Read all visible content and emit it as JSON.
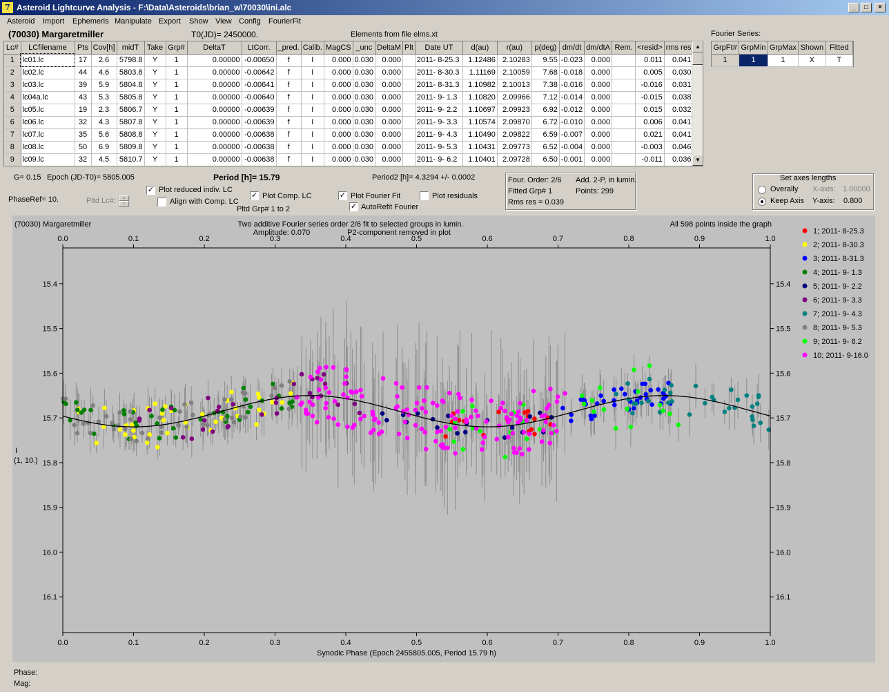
{
  "window": {
    "title": "Asteroid Lightcurve Analysis - F:\\Data\\Asteroids\\brian_w\\70030\\ini.alc",
    "app_icon": "7",
    "buttons": {
      "minimize": "_",
      "maximize": "□",
      "close": "×"
    }
  },
  "menu": [
    "Asteroid",
    "Import",
    "Ephemeris",
    "Manipulate",
    "Export",
    "Show",
    "View",
    "Config",
    "FourierFit"
  ],
  "header": {
    "asteroid": "(70030) Margaretmiller",
    "t0": "T0(JD)= 2450000.",
    "elements": "Elements from file elms.xt"
  },
  "table": {
    "columns": [
      "Lc#",
      "LCfilename",
      "Pts",
      "Cov[h]",
      "midT",
      "Take",
      "Grp#",
      "DeltaT",
      "LtCorr.",
      "_pred.",
      "Calib.",
      "MagCS",
      "_unc",
      "DeltaM",
      "Plt",
      "Date UT",
      "d(au)",
      "r(au)",
      "p(deg)",
      "dm/dt",
      "dm/dtA",
      "Rem.",
      "<resid>",
      "rms res"
    ],
    "rows": [
      [
        "1",
        "lc01.lc",
        "17",
        "2.6",
        "5798.8",
        "Y",
        "1",
        "0.00000",
        "-0.00650",
        "f",
        "I",
        "0.000",
        "0.030",
        "0.000",
        "",
        "2011- 8-25.3",
        "1.12486",
        "2.10283",
        "9.55",
        "-0.023",
        "0.000",
        "",
        "0.011",
        "0.041"
      ],
      [
        "2",
        "lc02.lc",
        "44",
        "4.6",
        "5803.8",
        "Y",
        "1",
        "0.00000",
        "-0.00642",
        "f",
        "I",
        "0.000",
        "0.030",
        "0.000",
        "",
        "2011- 8-30.3",
        "1.11169",
        "2.10059",
        "7.68",
        "-0.018",
        "0.000",
        "",
        "0.005",
        "0.030"
      ],
      [
        "3",
        "lc03.lc",
        "39",
        "5.9",
        "5804.8",
        "Y",
        "1",
        "0.00000",
        "-0.00641",
        "f",
        "I",
        "0.000",
        "0.030",
        "0.000",
        "",
        "2011- 8-31.3",
        "1.10982",
        "2.10013",
        "7.38",
        "-0.016",
        "0.000",
        "",
        "-0.016",
        "0.031"
      ],
      [
        "4",
        "lc04a.lc",
        "43",
        "5.3",
        "5805.8",
        "Y",
        "1",
        "0.00000",
        "-0.00640",
        "f",
        "I",
        "0.000",
        "0.030",
        "0.000",
        "",
        "2011- 9- 1.3",
        "1.10820",
        "2.09966",
        "7.12",
        "-0.014",
        "0.000",
        "",
        "-0.015",
        "0.038"
      ],
      [
        "5",
        "lc05.lc",
        "19",
        "2.3",
        "5806.7",
        "Y",
        "1",
        "0.00000",
        "-0.00639",
        "f",
        "I",
        "0.000",
        "0.030",
        "0.000",
        "",
        "2011- 9- 2.2",
        "1.10697",
        "2.09923",
        "6.92",
        "-0.012",
        "0.000",
        "",
        "0.015",
        "0.032"
      ],
      [
        "6",
        "lc06.lc",
        "32",
        "4.3",
        "5807.8",
        "Y",
        "1",
        "0.00000",
        "-0.00639",
        "f",
        "I",
        "0.000",
        "0.030",
        "0.000",
        "",
        "2011- 9- 3.3",
        "1.10574",
        "2.09870",
        "6.72",
        "-0.010",
        "0.000",
        "",
        "0.006",
        "0.041"
      ],
      [
        "7",
        "lc07.lc",
        "35",
        "5.6",
        "5808.8",
        "Y",
        "1",
        "0.00000",
        "-0.00638",
        "f",
        "I",
        "0.000",
        "0.030",
        "0.000",
        "",
        "2011- 9- 4.3",
        "1.10490",
        "2.09822",
        "6.59",
        "-0.007",
        "0.000",
        "",
        "0.021",
        "0.041"
      ],
      [
        "8",
        "lc08.lc",
        "50",
        "6.9",
        "5809.8",
        "Y",
        "1",
        "0.00000",
        "-0.00638",
        "f",
        "I",
        "0.000",
        "0.030",
        "0.000",
        "",
        "2011- 9- 5.3",
        "1.10431",
        "2.09773",
        "6.52",
        "-0.004",
        "0.000",
        "",
        "-0.003",
        "0.046"
      ],
      [
        "9",
        "lc09.lc",
        "32",
        "4.5",
        "5810.7",
        "Y",
        "1",
        "0.00000",
        "-0.00638",
        "f",
        "I",
        "0.000",
        "0.030",
        "0.000",
        "",
        "2011- 9- 6.2",
        "1.10401",
        "2.09728",
        "6.50",
        "-0.001",
        "0.000",
        "",
        "-0.011",
        "0.036"
      ]
    ]
  },
  "fourier_series": {
    "label": "Fourier Series:",
    "columns": [
      "GrpFt#",
      "GrpMin",
      "GrpMax",
      "Shown",
      "Fitted"
    ],
    "row": [
      "1",
      "1",
      "1",
      "X",
      "T"
    ]
  },
  "params": {
    "g": "G= 0.15",
    "epoch": "Epoch (JD-T0)= 5805.005",
    "period": "Period [h]= 15.79",
    "period2": "Period2 [h]= 4.3294 +/- 0.0002",
    "phaseref": "PhaseRef= 10.",
    "pltd_lc": "Pltd Lc#:",
    "pltd_grp": "Pltd Grp#  1   to   2"
  },
  "checkboxes": {
    "plot_reduced": {
      "label": "Plot reduced indiv. LC",
      "checked": true
    },
    "align_comp": {
      "label": "Align with Comp. LC",
      "checked": false
    },
    "plot_comp": {
      "label": "Plot Comp. LC",
      "checked": true
    },
    "plot_fourier": {
      "label": "Plot Fourier Fit",
      "checked": true
    },
    "plot_residuals": {
      "label": "Plot residuals",
      "checked": false
    },
    "autorefit": {
      "label": "AutoRefit Fourier",
      "checked": true
    }
  },
  "fit_info": {
    "order": "Four. Order:  2/6",
    "add": "Add. 2-P, in lumin.",
    "fitted": "Fitted Grp# 1",
    "points": "Points: 299",
    "rms": "Rms res      = 0.039"
  },
  "axes_box": {
    "title": "Set axes lengths",
    "overally": "Overally",
    "keep_axis": "Keep Axis",
    "xaxis_label": "X-axis:",
    "xaxis_value": "1.00000",
    "yaxis_label": "Y-axis:",
    "yaxis_value": "0.800",
    "selected": "Keep Axis"
  },
  "plot": {
    "name": "(70030) Margaretmiller",
    "subtitle1": "Two additive Fourier series order 2/6 fit to selected groups in lumin.",
    "subtitle2a": "Amplitude: 0.070",
    "subtitle2b": "P2-component removed in plot",
    "points_note": "All 598 points inside the graph",
    "ylabel1": "I",
    "ylabel2": "(1, 10.)",
    "xlabel": "Synodic Phase (Epoch 2455805.005, Period 15.79 h)",
    "background": "#c0c0c0",
    "plot_bg": "#c0c0c0"
  },
  "chart_data": {
    "type": "scatter",
    "xlabel": "Synodic Phase (Epoch 2455805.005, Period 15.79 h)",
    "ylabel": "I",
    "xlim": [
      0,
      1
    ],
    "ylim": [
      15.32,
      16.18
    ],
    "y_inverted": true,
    "x_ticks": [
      "0.0",
      "0.1",
      "0.2",
      "0.3",
      "0.4",
      "0.5",
      "0.6",
      "0.7",
      "0.8",
      "0.9",
      "1.0"
    ],
    "y_ticks": [
      "15.4",
      "15.5",
      "15.6",
      "15.7",
      "15.8",
      "15.9",
      "16.0",
      "16.1"
    ],
    "fit_curve": {
      "mean": 15.685,
      "amplitude": 0.035,
      "min_phase": 0.1,
      "max_phase": 0.35
    },
    "series": [
      {
        "name": "1; 2011- 8-25.3",
        "color": "#ff0000",
        "phase_range": [
          0.51,
          0.69
        ],
        "center": 15.68,
        "spread": 0.04
      },
      {
        "name": "2; 2011- 8-30.3",
        "color": "#ffff00",
        "phase_range": [
          0.02,
          0.34
        ],
        "center": 15.7,
        "spread": 0.05
      },
      {
        "name": "3; 2011- 8-31.3",
        "color": "#0000ff",
        "phase_range": [
          0.7,
          0.86
        ],
        "center": 15.64,
        "spread": 0.03
      },
      {
        "name": "4; 2011- 9- 1.3",
        "color": "#008000",
        "phase_range": [
          0.0,
          0.33
        ],
        "center": 15.66,
        "spread": 0.04
      },
      {
        "name": "5; 2011- 9- 2.2",
        "color": "#000080",
        "phase_range": [
          0.45,
          0.7
        ],
        "center": 15.72,
        "spread": 0.03
      },
      {
        "name": "6; 2011- 9- 3.3",
        "color": "#800080",
        "phase_range": [
          0.1,
          0.42
        ],
        "center": 15.68,
        "spread": 0.05
      },
      {
        "name": "7; 2011- 9- 4.3",
        "color": "#008080",
        "phase_range": [
          0.78,
          1.0
        ],
        "center": 15.7,
        "spread": 0.04
      },
      {
        "name": "8; 2011- 9- 5.3",
        "color": "#808080",
        "phase_range": [
          0.0,
          0.35
        ],
        "center": 15.67,
        "spread": 0.04
      },
      {
        "name": "9; 2011- 9- 6.2",
        "color": "#00ff00",
        "phase_range": [
          0.54,
          0.88
        ],
        "center": 15.66,
        "spread": 0.07
      },
      {
        "name": "10; 2011- 9-16.0",
        "color": "#ff00ff",
        "phase_range": [
          0.33,
          0.71
        ],
        "center": 15.7,
        "spread": 0.07
      }
    ]
  },
  "status": {
    "phase": "Phase:",
    "mag": "Mag:"
  }
}
